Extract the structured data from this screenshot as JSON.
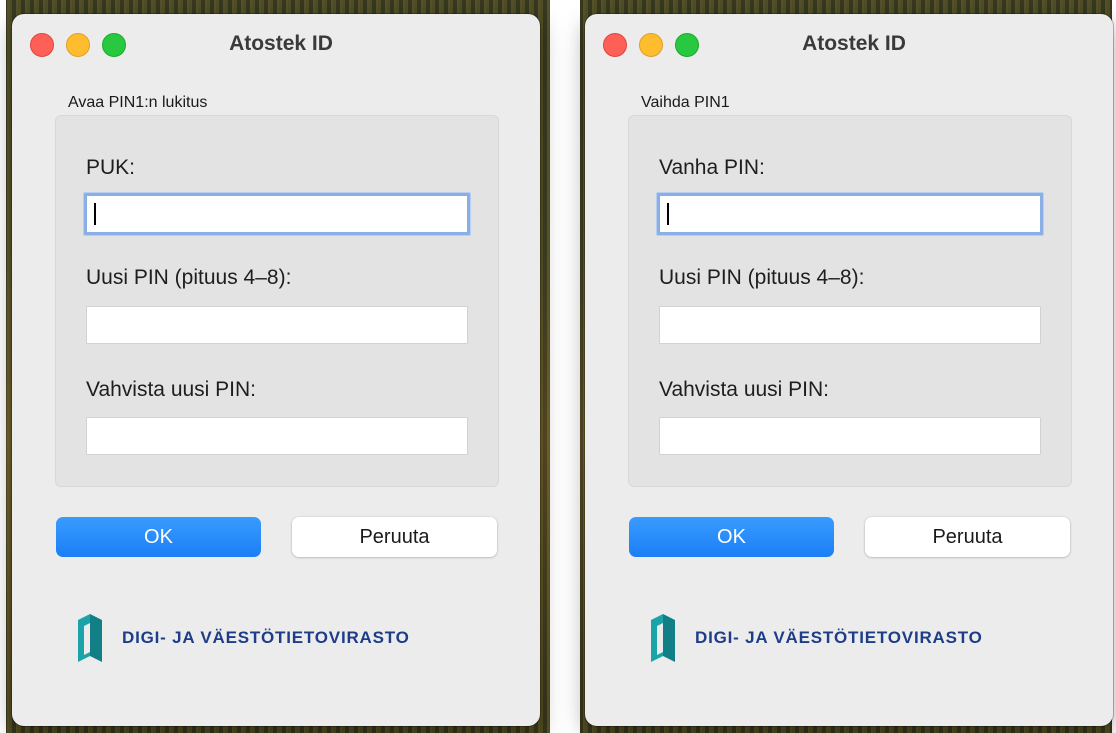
{
  "windows": [
    {
      "title": "Atostek ID",
      "group_label": "Avaa PIN1:n lukitus",
      "fields": [
        {
          "label": "PUK:",
          "value": ""
        },
        {
          "label": "Uusi PIN (pituus 4–8):",
          "value": ""
        },
        {
          "label": "Vahvista uusi PIN:",
          "value": ""
        }
      ],
      "ok_label": "OK",
      "cancel_label": "Peruuta",
      "logo_text": "DIGI- JA VÄESTÖTIETOVIRASTO"
    },
    {
      "title": "Atostek ID",
      "group_label": "Vaihda PIN1",
      "fields": [
        {
          "label": "Vanha PIN:",
          "value": ""
        },
        {
          "label": "Uusi PIN (pituus 4–8):",
          "value": ""
        },
        {
          "label": "Vahvista uusi PIN:",
          "value": ""
        }
      ],
      "ok_label": "OK",
      "cancel_label": "Peruuta",
      "logo_text": "DIGI- JA VÄESTÖTIETOVIRASTO"
    }
  ],
  "colors": {
    "accent": "#1a7ff5",
    "logo_blue": "#1d3d88",
    "logo_teal": "#1aa3a8"
  },
  "icons": [
    "close-icon",
    "minimize-icon",
    "zoom-icon",
    "dvv-logo-icon"
  ]
}
